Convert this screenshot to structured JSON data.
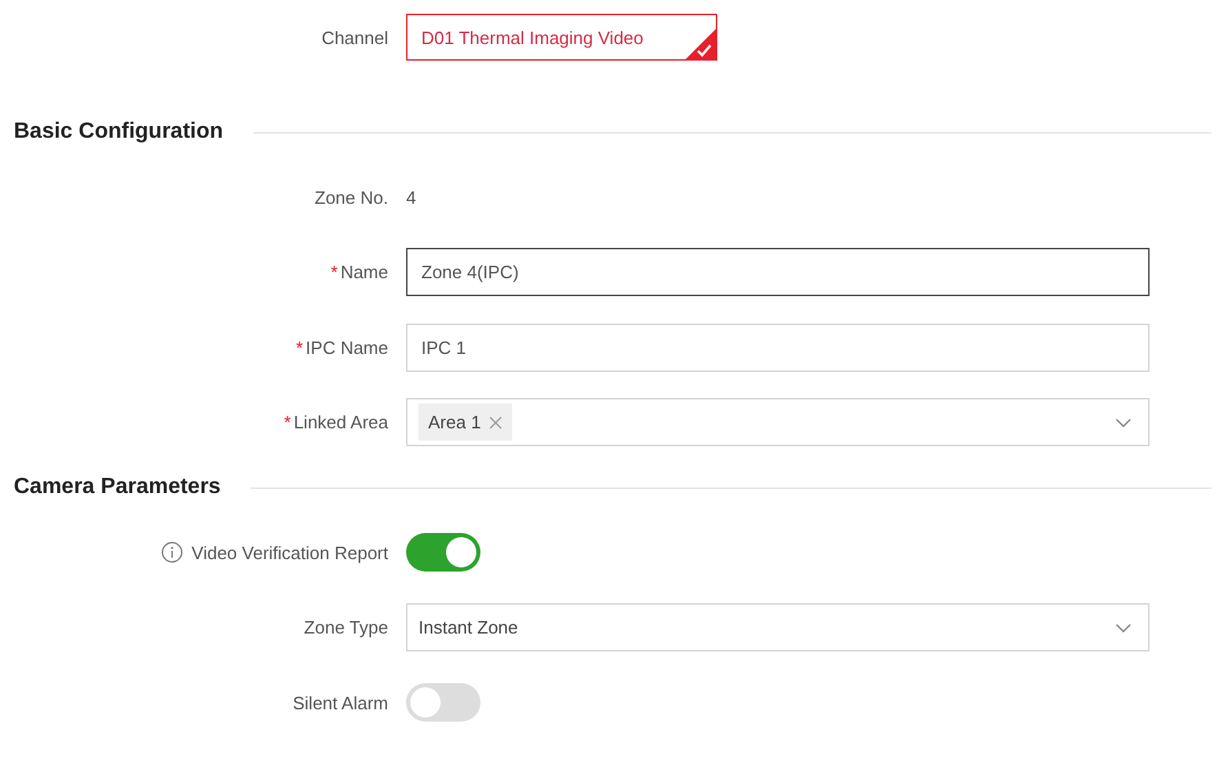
{
  "channel": {
    "label": "Channel",
    "chips": [
      {
        "text": "D01 Thermal Imaging Video",
        "selected": true
      }
    ]
  },
  "sections": [
    {
      "title": "Basic Configuration",
      "rows": [
        {
          "kind": "text",
          "label": "Zone No.",
          "value": "4"
        },
        {
          "kind": "input",
          "required_mark": "*",
          "label": "Name",
          "value": "Zone 4(IPC)",
          "focused": true
        },
        {
          "kind": "input",
          "required_mark": "*",
          "label": "IPC Name",
          "value": "IPC 1",
          "focused": false
        },
        {
          "kind": "tags",
          "required_mark": "*",
          "label": "Linked Area",
          "tags": [
            "Area 1"
          ]
        }
      ]
    },
    {
      "title": "Camera Parameters",
      "rows": [
        {
          "kind": "switch",
          "label": "Video Verification Report",
          "info": true,
          "on": true
        },
        {
          "kind": "select",
          "label": "Zone Type",
          "value": "Instant Zone"
        },
        {
          "kind": "switch",
          "label": "Silent Alarm",
          "info": false,
          "on": false
        }
      ]
    }
  ]
}
